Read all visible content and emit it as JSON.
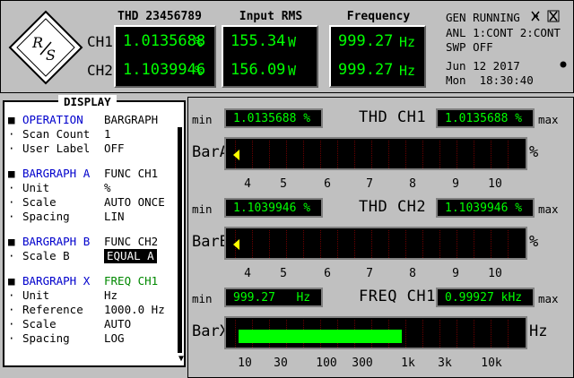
{
  "top": {
    "col_heads": [
      "THD 23456789",
      "Input RMS",
      "Frequency"
    ],
    "channels": [
      {
        "label": "CH1",
        "thd": "1.0135688",
        "thd_unit": "%",
        "rms": "155.34",
        "rms_unit": "W",
        "freq": "999.27",
        "freq_unit": "Hz"
      },
      {
        "label": "CH2",
        "thd": "1.1039946",
        "thd_unit": "%",
        "rms": "156.09",
        "rms_unit": "W",
        "freq": "999.27",
        "freq_unit": "Hz"
      }
    ],
    "status": {
      "line1": "GEN RUNNING",
      "line2": "ANL 1:CONT 2:CONT",
      "line3": "SWP OFF",
      "date": "Jun 12 2017",
      "time": "Mon  18:30:40"
    }
  },
  "menu": {
    "title": "DISPLAY",
    "rows": [
      {
        "bullet": "■",
        "label": "OPERATION",
        "value": "BARGRAPH",
        "heading": true
      },
      {
        "bullet": "·",
        "label": "Scan Count",
        "value": "1"
      },
      {
        "bullet": "·",
        "label": "User Label",
        "value": "OFF"
      },
      {
        "bullet": "■",
        "label": "BARGRAPH A",
        "value": "FUNC CH1",
        "heading": true
      },
      {
        "bullet": "·",
        "label": "Unit",
        "value": "%"
      },
      {
        "bullet": "·",
        "label": "Scale",
        "value": "AUTO ONCE"
      },
      {
        "bullet": "·",
        "label": "Spacing",
        "value": "LIN"
      },
      {
        "bullet": "■",
        "label": "BARGRAPH B",
        "value": "FUNC CH2",
        "heading": true
      },
      {
        "bullet": "·",
        "label": "Scale B",
        "value": "EQUAL A"
      },
      {
        "bullet": "■",
        "label": "BARGRAPH X",
        "value": "FREQ CH1",
        "heading": true
      },
      {
        "bullet": "·",
        "label": "Unit",
        "value": "Hz"
      },
      {
        "bullet": "·",
        "label": "Reference",
        "value": "1000.0 Hz"
      },
      {
        "bullet": "·",
        "label": "Scale",
        "value": "AUTO"
      },
      {
        "bullet": "·",
        "label": "Spacing",
        "value": "LOG"
      }
    ]
  },
  "bargraphs": [
    {
      "name": "BarA",
      "title": "THD   CH1",
      "min_label": "min",
      "max_label": "max",
      "min_value": "1.0135688 %",
      "max_value": "1.0135688 %",
      "unit": "%",
      "scale": [
        "4",
        "5",
        "6",
        "7",
        "8",
        "9",
        "10"
      ],
      "fill": 0.0
    },
    {
      "name": "BarB",
      "title": "THD   CH2",
      "min_label": "min",
      "max_label": "max",
      "min_value": "1.1039946 %",
      "max_value": "1.1039946 %",
      "unit": "%",
      "scale": [
        "4",
        "5",
        "6",
        "7",
        "8",
        "9",
        "10"
      ],
      "fill": 0.0
    },
    {
      "name": "BarX",
      "title": "FREQ CH1",
      "min_label": "min",
      "max_label": "max",
      "min_value": "999.27   Hz",
      "max_value": "0.99927 kHz",
      "unit": "Hz",
      "scale": [
        "10",
        "30",
        "100",
        "300",
        "1k",
        "3k",
        "10k"
      ],
      "fill": 0.55
    }
  ],
  "colors": {
    "lcd_text": "#00ff00",
    "heading": "#0000cc",
    "panel": "#c0c0c0"
  }
}
